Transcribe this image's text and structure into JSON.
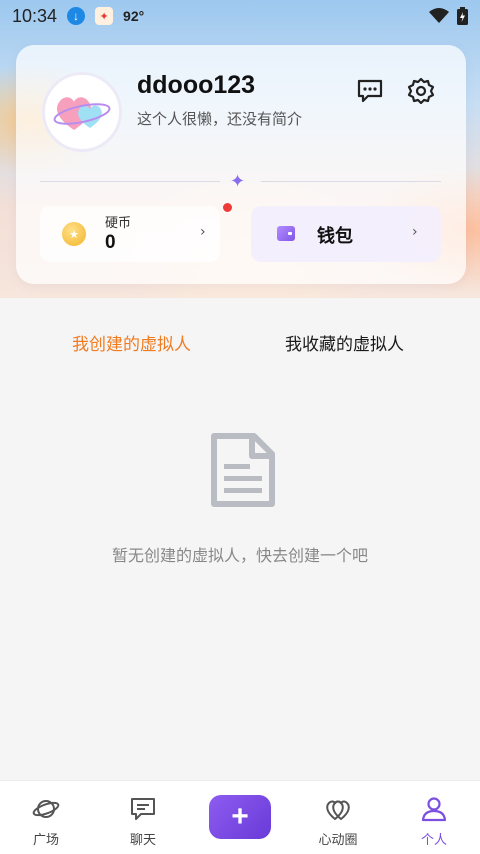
{
  "status_bar": {
    "time": "10:34",
    "temperature": "92°"
  },
  "profile": {
    "username": "ddooo123",
    "bio": "这个人很懒，还没有简介",
    "coins_label": "硬币",
    "coins_value": "0",
    "wallet_label": "钱包"
  },
  "tabs": [
    {
      "label": "我创建的虚拟人",
      "active": true
    },
    {
      "label": "我收藏的虚拟人",
      "active": false
    }
  ],
  "empty_state": {
    "message": "暂无创建的虚拟人，快去创建一个吧"
  },
  "bottom_nav": {
    "plaza": "广场",
    "chat": "聊天",
    "create": "+",
    "circle": "心动圈",
    "me": "个人"
  },
  "colors": {
    "accent": "#7b4fe0",
    "active_tab": "#f07c22",
    "badge": "#ef3a3a"
  },
  "icons": [
    "download-icon",
    "app-notification-icon",
    "wifi-icon",
    "battery-icon",
    "message-icon",
    "settings-icon",
    "sparkle-icon",
    "coin-icon",
    "wallet-icon",
    "document-icon",
    "planet-icon",
    "chat-icon",
    "plus-icon",
    "hearts-icon",
    "person-icon"
  ]
}
